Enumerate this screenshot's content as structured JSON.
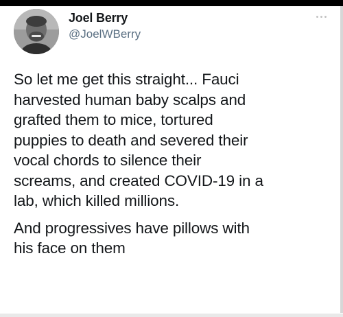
{
  "tweet": {
    "author": {
      "display_name": "Joel Berry",
      "handle": "@JoelWBerry",
      "avatar_icon": "avatar-photo"
    },
    "more_icon": "more-horizontal-icon",
    "paragraphs": [
      "So let me get this straight... Fauci\nharvested human baby scalps and\ngrafted them to mice, tortured\npuppies to death and severed their\nvocal chords to silence their\nscreams, and created COVID-19 in a\nlab, which killed millions.",
      "And progressives have pillows with\nhis face on them"
    ]
  },
  "colors": {
    "text_primary": "#14171a",
    "text_secondary": "#5b7083",
    "background": "#ffffff"
  }
}
